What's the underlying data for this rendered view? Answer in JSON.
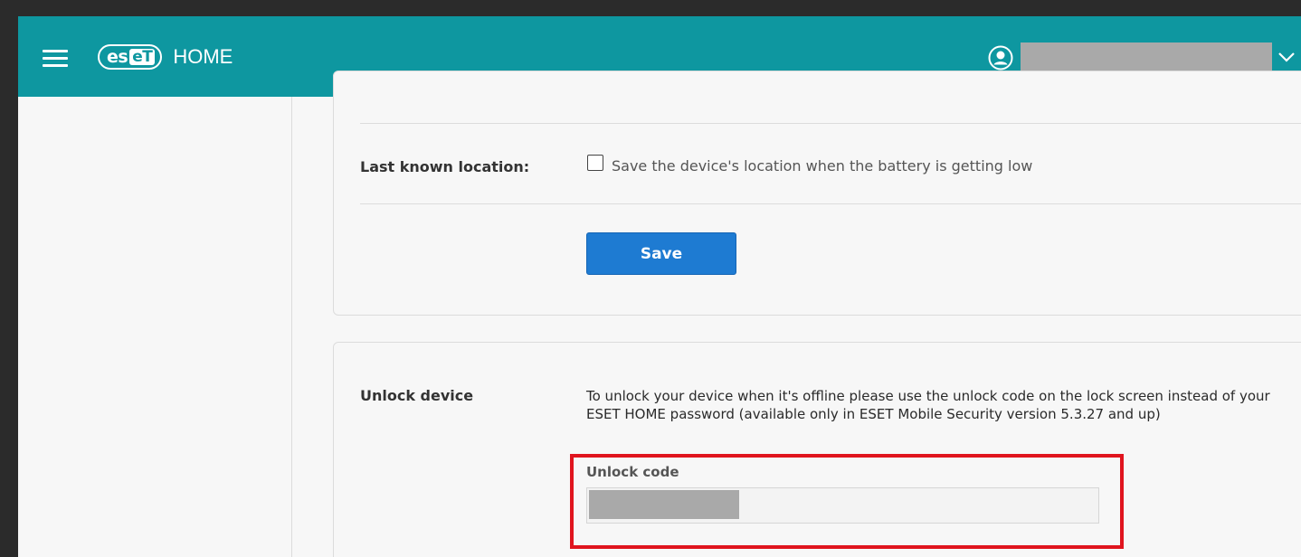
{
  "header": {
    "logo_mark": "eset",
    "app_name": "HOME",
    "user_name": "",
    "brand_color": "#0e97a0"
  },
  "settings": {
    "last_known_location": {
      "label": "Last known location:",
      "checkbox_label": "Save the device's location when the battery is getting low",
      "checked": false
    },
    "save_label": "Save"
  },
  "unlock": {
    "label": "Unlock device",
    "description": "To unlock your device when it's offline please use the unlock code on the lock screen instead of your ESET HOME password (available only in ESET Mobile Security version 5.3.27 and up)",
    "code_label": "Unlock code",
    "code_value": "",
    "highlight_color": "#e0141e"
  },
  "icons": {
    "menu": "hamburger-menu-icon",
    "user": "user-icon",
    "dropdown": "chevron-down-icon"
  }
}
